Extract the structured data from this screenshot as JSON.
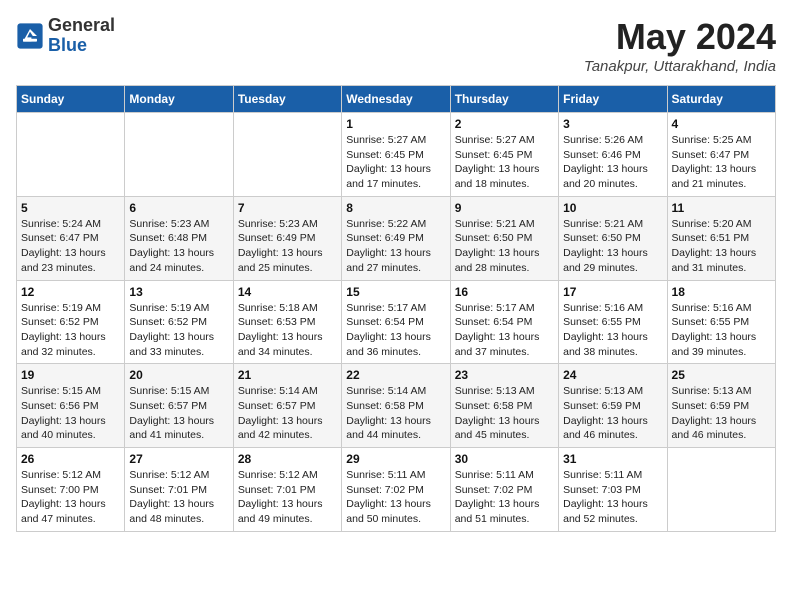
{
  "header": {
    "logo_general": "General",
    "logo_blue": "Blue",
    "main_title": "May 2024",
    "subtitle": "Tanakpur, Uttarakhand, India"
  },
  "weekdays": [
    "Sunday",
    "Monday",
    "Tuesday",
    "Wednesday",
    "Thursday",
    "Friday",
    "Saturday"
  ],
  "weeks": [
    [
      {
        "date": "",
        "info": ""
      },
      {
        "date": "",
        "info": ""
      },
      {
        "date": "",
        "info": ""
      },
      {
        "date": "1",
        "info": "Sunrise: 5:27 AM\nSunset: 6:45 PM\nDaylight: 13 hours and 17 minutes."
      },
      {
        "date": "2",
        "info": "Sunrise: 5:27 AM\nSunset: 6:45 PM\nDaylight: 13 hours and 18 minutes."
      },
      {
        "date": "3",
        "info": "Sunrise: 5:26 AM\nSunset: 6:46 PM\nDaylight: 13 hours and 20 minutes."
      },
      {
        "date": "4",
        "info": "Sunrise: 5:25 AM\nSunset: 6:47 PM\nDaylight: 13 hours and 21 minutes."
      }
    ],
    [
      {
        "date": "5",
        "info": "Sunrise: 5:24 AM\nSunset: 6:47 PM\nDaylight: 13 hours and 23 minutes."
      },
      {
        "date": "6",
        "info": "Sunrise: 5:23 AM\nSunset: 6:48 PM\nDaylight: 13 hours and 24 minutes."
      },
      {
        "date": "7",
        "info": "Sunrise: 5:23 AM\nSunset: 6:49 PM\nDaylight: 13 hours and 25 minutes."
      },
      {
        "date": "8",
        "info": "Sunrise: 5:22 AM\nSunset: 6:49 PM\nDaylight: 13 hours and 27 minutes."
      },
      {
        "date": "9",
        "info": "Sunrise: 5:21 AM\nSunset: 6:50 PM\nDaylight: 13 hours and 28 minutes."
      },
      {
        "date": "10",
        "info": "Sunrise: 5:21 AM\nSunset: 6:50 PM\nDaylight: 13 hours and 29 minutes."
      },
      {
        "date": "11",
        "info": "Sunrise: 5:20 AM\nSunset: 6:51 PM\nDaylight: 13 hours and 31 minutes."
      }
    ],
    [
      {
        "date": "12",
        "info": "Sunrise: 5:19 AM\nSunset: 6:52 PM\nDaylight: 13 hours and 32 minutes."
      },
      {
        "date": "13",
        "info": "Sunrise: 5:19 AM\nSunset: 6:52 PM\nDaylight: 13 hours and 33 minutes."
      },
      {
        "date": "14",
        "info": "Sunrise: 5:18 AM\nSunset: 6:53 PM\nDaylight: 13 hours and 34 minutes."
      },
      {
        "date": "15",
        "info": "Sunrise: 5:17 AM\nSunset: 6:54 PM\nDaylight: 13 hours and 36 minutes."
      },
      {
        "date": "16",
        "info": "Sunrise: 5:17 AM\nSunset: 6:54 PM\nDaylight: 13 hours and 37 minutes."
      },
      {
        "date": "17",
        "info": "Sunrise: 5:16 AM\nSunset: 6:55 PM\nDaylight: 13 hours and 38 minutes."
      },
      {
        "date": "18",
        "info": "Sunrise: 5:16 AM\nSunset: 6:55 PM\nDaylight: 13 hours and 39 minutes."
      }
    ],
    [
      {
        "date": "19",
        "info": "Sunrise: 5:15 AM\nSunset: 6:56 PM\nDaylight: 13 hours and 40 minutes."
      },
      {
        "date": "20",
        "info": "Sunrise: 5:15 AM\nSunset: 6:57 PM\nDaylight: 13 hours and 41 minutes."
      },
      {
        "date": "21",
        "info": "Sunrise: 5:14 AM\nSunset: 6:57 PM\nDaylight: 13 hours and 42 minutes."
      },
      {
        "date": "22",
        "info": "Sunrise: 5:14 AM\nSunset: 6:58 PM\nDaylight: 13 hours and 44 minutes."
      },
      {
        "date": "23",
        "info": "Sunrise: 5:13 AM\nSunset: 6:58 PM\nDaylight: 13 hours and 45 minutes."
      },
      {
        "date": "24",
        "info": "Sunrise: 5:13 AM\nSunset: 6:59 PM\nDaylight: 13 hours and 46 minutes."
      },
      {
        "date": "25",
        "info": "Sunrise: 5:13 AM\nSunset: 6:59 PM\nDaylight: 13 hours and 46 minutes."
      }
    ],
    [
      {
        "date": "26",
        "info": "Sunrise: 5:12 AM\nSunset: 7:00 PM\nDaylight: 13 hours and 47 minutes."
      },
      {
        "date": "27",
        "info": "Sunrise: 5:12 AM\nSunset: 7:01 PM\nDaylight: 13 hours and 48 minutes."
      },
      {
        "date": "28",
        "info": "Sunrise: 5:12 AM\nSunset: 7:01 PM\nDaylight: 13 hours and 49 minutes."
      },
      {
        "date": "29",
        "info": "Sunrise: 5:11 AM\nSunset: 7:02 PM\nDaylight: 13 hours and 50 minutes."
      },
      {
        "date": "30",
        "info": "Sunrise: 5:11 AM\nSunset: 7:02 PM\nDaylight: 13 hours and 51 minutes."
      },
      {
        "date": "31",
        "info": "Sunrise: 5:11 AM\nSunset: 7:03 PM\nDaylight: 13 hours and 52 minutes."
      },
      {
        "date": "",
        "info": ""
      }
    ]
  ]
}
